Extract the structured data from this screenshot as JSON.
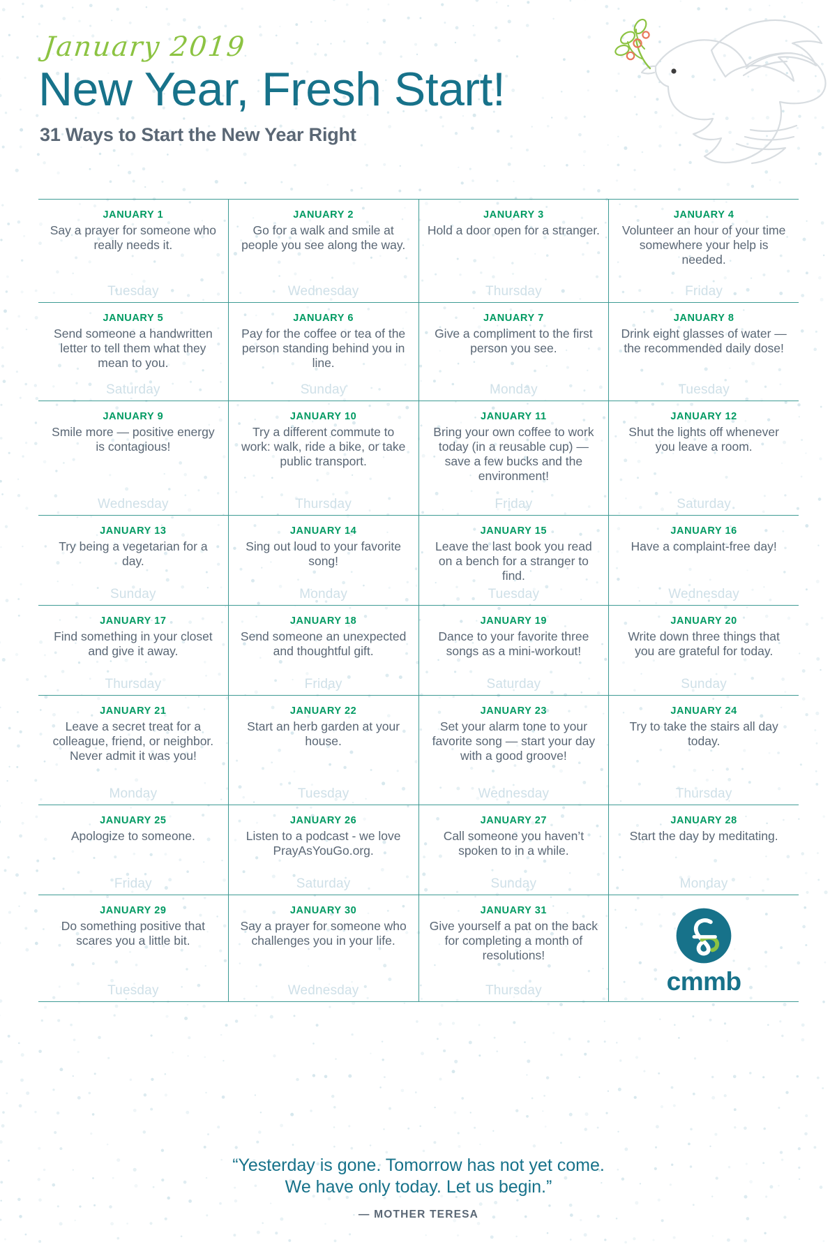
{
  "header": {
    "month_script": "January 2019",
    "title": "New Year, Fresh Start!",
    "subtitle": "31 Ways to Start the New Year Right"
  },
  "colors": {
    "script_green": "#8cc342",
    "title_teal": "#17728a",
    "subtitle_gray": "#5a6775",
    "date_green": "#009a62",
    "body_gray": "#5a6775",
    "weekday_blue": "#cfe0e8",
    "rule_teal": "#3e9b94",
    "dot_blue": "#cfe3ea",
    "logo_teal": "#17728a",
    "logo_green": "#8cc342"
  },
  "calendar": {
    "rows": [
      [
        {
          "date": "JANUARY 1",
          "text": "Say a prayer for someone who really needs it.",
          "weekday": "Tuesday"
        },
        {
          "date": "JANUARY 2",
          "text": "Go for a walk and smile at people you see along the way.",
          "weekday": "Wednesday"
        },
        {
          "date": "JANUARY 3",
          "text": "Hold a door open for a stranger.",
          "weekday": "Thursday"
        },
        {
          "date": "JANUARY 4",
          "text": "Volunteer an hour of your time somewhere your help is needed.",
          "weekday": "Friday"
        }
      ],
      [
        {
          "date": "JANUARY 5",
          "text": "Send someone a handwritten letter to tell them what they mean to you.",
          "weekday": "Saturday"
        },
        {
          "date": "JANUARY 6",
          "text": "Pay for the coffee or tea of the person standing behind you in line.",
          "weekday": "Sunday"
        },
        {
          "date": "JANUARY 7",
          "text": "Give a compliment to the first person you see.",
          "weekday": "Monday"
        },
        {
          "date": "JANUARY 8",
          "text": "Drink eight glasses of water — the recommended daily dose!",
          "weekday": "Tuesday"
        }
      ],
      [
        {
          "date": "JANUARY 9",
          "text": "Smile more — positive energy is contagious!",
          "weekday": "Wednesday"
        },
        {
          "date": "JANUARY 10",
          "text": "Try a different commute to work: walk, ride a bike, or take public transport.",
          "weekday": "Thursday"
        },
        {
          "date": "JANUARY 11",
          "text": "Bring your own coffee to work today (in a reusable cup) — save a few bucks and the environment!",
          "weekday": "Friday"
        },
        {
          "date": "JANUARY 12",
          "text": "Shut the lights off whenever you leave a room.",
          "weekday": "Saturday"
        }
      ],
      [
        {
          "date": "JANUARY 13",
          "text": "Try being a vegetarian for a day.",
          "weekday": "Sunday"
        },
        {
          "date": "JANUARY 14",
          "text": "Sing out loud to your favorite song!",
          "weekday": "Monday"
        },
        {
          "date": "JANUARY 15",
          "text": "Leave the last book you read on a bench for a stranger to find.",
          "weekday": "Tuesday"
        },
        {
          "date": "JANUARY 16",
          "text": "Have a complaint-free day!",
          "weekday": "Wednesday"
        }
      ],
      [
        {
          "date": "JANUARY 17",
          "text": "Find something in your closet and give it away.",
          "weekday": "Thursday"
        },
        {
          "date": "JANUARY 18",
          "text": "Send someone an unexpected and thoughtful gift.",
          "weekday": "Friday"
        },
        {
          "date": "JANUARY 19",
          "text": "Dance to your favorite three songs as a mini-workout!",
          "weekday": "Saturday"
        },
        {
          "date": "JANUARY 20",
          "text": "Write down three things that you are grateful for today.",
          "weekday": "Sunday"
        }
      ],
      [
        {
          "date": "JANUARY 21",
          "text": "Leave a secret treat for a colleague, friend, or neighbor. Never admit it was you!",
          "weekday": "Monday"
        },
        {
          "date": "JANUARY 22",
          "text": "Start an herb garden at your house.",
          "weekday": "Tuesday"
        },
        {
          "date": "JANUARY 23",
          "text": "Set your alarm tone to your favorite song — start your day with a good groove!",
          "weekday": "Wednesday"
        },
        {
          "date": "JANUARY 24",
          "text": "Try to take the stairs all day today.",
          "weekday": "Thursday"
        }
      ],
      [
        {
          "date": "JANUARY 25",
          "text": "Apologize to someone.",
          "weekday": "Friday"
        },
        {
          "date": "JANUARY 26",
          "text": "Listen to a podcast - we love PrayAsYouGo.org.",
          "weekday": "Saturday"
        },
        {
          "date": "JANUARY 27",
          "text": "Call someone you haven’t spoken to in a while.",
          "weekday": "Sunday"
        },
        {
          "date": "JANUARY 28",
          "text": "Start the day by meditating.",
          "weekday": "Monday"
        }
      ],
      [
        {
          "date": "JANUARY 29",
          "text": "Do something positive that scares you a little bit.",
          "weekday": "Tuesday"
        },
        {
          "date": "JANUARY 30",
          "text": "Say a prayer for someone who challenges you in your life.",
          "weekday": "Wednesday"
        },
        {
          "date": "JANUARY 31",
          "text": "Give yourself a pat on the back for completing a month of resolutions!",
          "weekday": "Thursday"
        }
      ]
    ]
  },
  "logo": {
    "wordmark": "cmmb",
    "mark_name": "cmmb-ampersand-mark"
  },
  "footer": {
    "quote_line1": "“Yesterday is gone. Tomorrow has not yet come.",
    "quote_line2": "We have only today. Let us begin.”",
    "attribution": "— MOTHER TERESA"
  }
}
